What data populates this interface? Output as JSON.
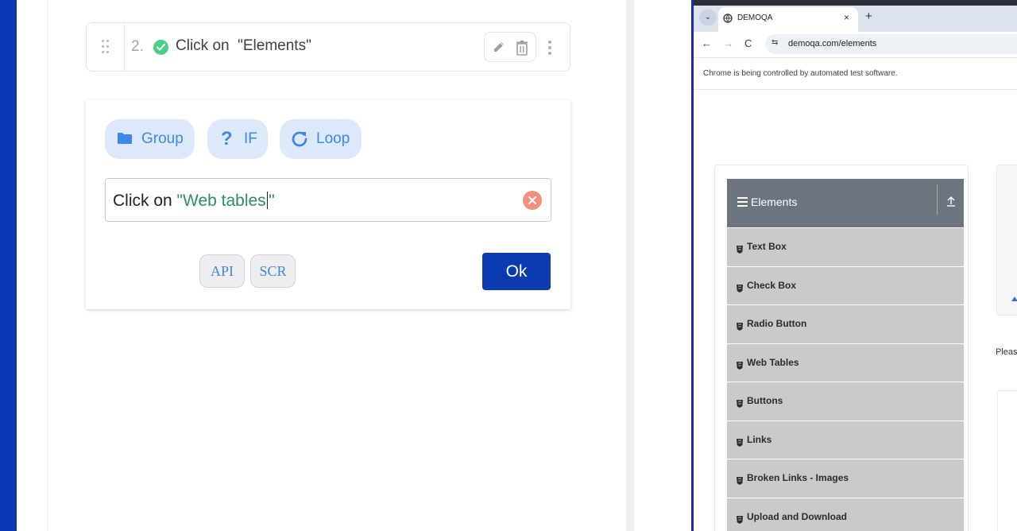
{
  "editor": {
    "step": {
      "number": "2.",
      "prefix": "Click on",
      "target": "\"Elements\"",
      "status": "success"
    },
    "add_panel": {
      "chips": [
        {
          "label": "Group",
          "icon": "folder-icon"
        },
        {
          "label": "IF",
          "icon": "question-icon"
        },
        {
          "label": "Loop",
          "icon": "refresh-icon"
        }
      ],
      "command_input": {
        "prefix": "Click on",
        "quoted_value": "\"Web tables",
        "closing_quote": "\""
      },
      "api_label": "API",
      "scr_label": "SCR",
      "ok_label": "Ok"
    },
    "colors": {
      "side_strip": "#0a37b6",
      "ok_button": "#0a3cb0",
      "chip_bg": "#dbe9fb",
      "chip_text": "#3f88ea",
      "success": "#4ccf83",
      "clear": "#f2907b",
      "quoted_text": "#2c8c62"
    }
  },
  "browser": {
    "tab_title": "DEMOQA",
    "tab_close": "×",
    "new_tab": "+",
    "url": "demoqa.com/elements",
    "automation_notice": "Chrome is being controlled by automated test software.",
    "nav": {
      "back": "←",
      "forward": "→",
      "reload": "C",
      "site_info": "⇆"
    },
    "sidebar": {
      "group_title": "Elements",
      "items": [
        {
          "label": "Text Box"
        },
        {
          "label": "Check Box"
        },
        {
          "label": "Radio Button"
        },
        {
          "label": "Web Tables"
        },
        {
          "label": "Buttons"
        },
        {
          "label": "Links"
        },
        {
          "label": "Broken Links - Images"
        },
        {
          "label": "Upload and Download"
        }
      ]
    },
    "content_snippet": "Pleas",
    "colors": {
      "group_header": "#6c757d",
      "menu_item": "#cacaca",
      "frame_border": "#1d28b4"
    }
  }
}
